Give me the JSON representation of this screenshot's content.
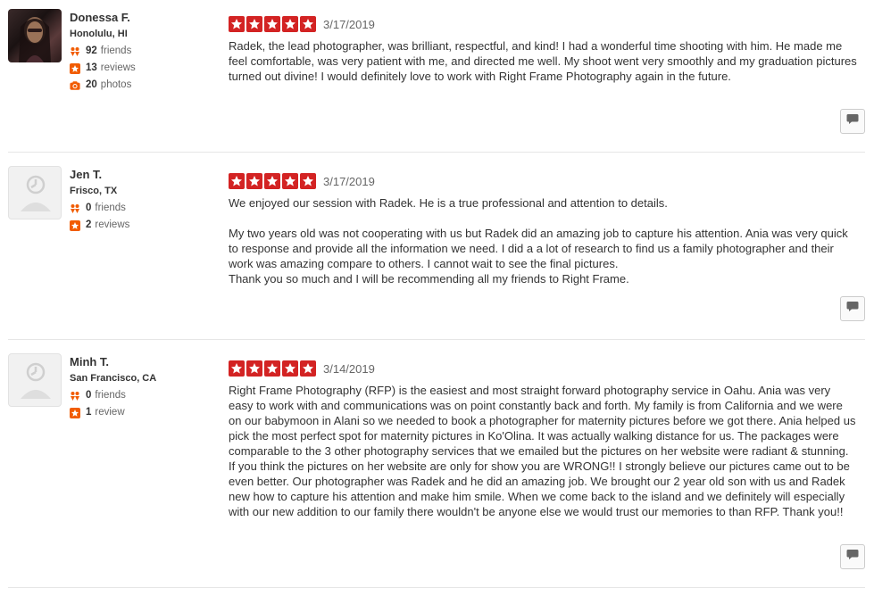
{
  "reviews": [
    {
      "name": "Donessa F.",
      "location": "Honolulu, HI",
      "friends_count": "92",
      "friends_label": "friends",
      "reviews_count": "13",
      "reviews_label": "reviews",
      "photos_count": "20",
      "photos_label": "photos",
      "rating": 5,
      "date": "3/17/2019",
      "text": "Radek, the lead photographer, was brilliant, respectful, and kind! I had a wonderful time shooting with him. He made me feel comfortable, was very patient with me, and directed me well. My shoot went very smoothly and my graduation pictures turned out divine! I would definitely love to work with Right Frame Photography again in the future."
    },
    {
      "name": "Jen T.",
      "location": "Frisco, TX",
      "friends_count": "0",
      "friends_label": "friends",
      "reviews_count": "2",
      "reviews_label": "reviews",
      "rating": 5,
      "date": "3/17/2019",
      "text": "We enjoyed our session with Radek. He is a true professional and attention to details.\n\nMy two years old was not cooperating with us but Radek did an amazing job to capture his attention. Ania was very quick to response and provide all the information we need. I did a a lot of research to find us a family photographer and their work was amazing compare to others.  I cannot wait to see the final pictures.\nThank you so much and I will be recommending all my friends to Right Frame."
    },
    {
      "name": "Minh T.",
      "location": "San Francisco, CA",
      "friends_count": "0",
      "friends_label": "friends",
      "reviews_count": "1",
      "reviews_label": "review",
      "rating": 5,
      "date": "3/14/2019",
      "text": "Right Frame Photography (RFP) is the easiest and most straight forward photography service in Oahu.  Ania was very easy to work with and communications was on point constantly back and forth.  My family is from California and we were on our babymoon in Alani so we needed to book a photographer for maternity pictures before we got there.  Ania helped us pick the most perfect spot for maternity pictures in Ko'Olina.  It was actually walking distance for us.  The packages were comparable to the 3 other photography services that we emailed but the pictures on her website were radiant & stunning.  If you think the pictures on her website are only for show you are WRONG!!  I strongly believe our pictures came out to be even better.  Our photographer was Radek and he did an amazing job.  We brought our 2 year old son with us and Radek new how to capture his attention and make him smile.  When we come back to the island and we definitely will especially with our new addition to our family there wouldn't be anyone else we would trust our memories to than RFP.  Thank you!!"
    }
  ],
  "colors": {
    "star_red": "#d32323",
    "friends_orange": "#f15c00",
    "divider": "#e6e6e6"
  },
  "icons": {
    "friends": "friends-icon",
    "reviews": "star-badge-icon",
    "photos": "camera-icon",
    "star": "star-icon",
    "comment": "speech-bubble-icon",
    "default_avatar": "default-user-icon"
  }
}
